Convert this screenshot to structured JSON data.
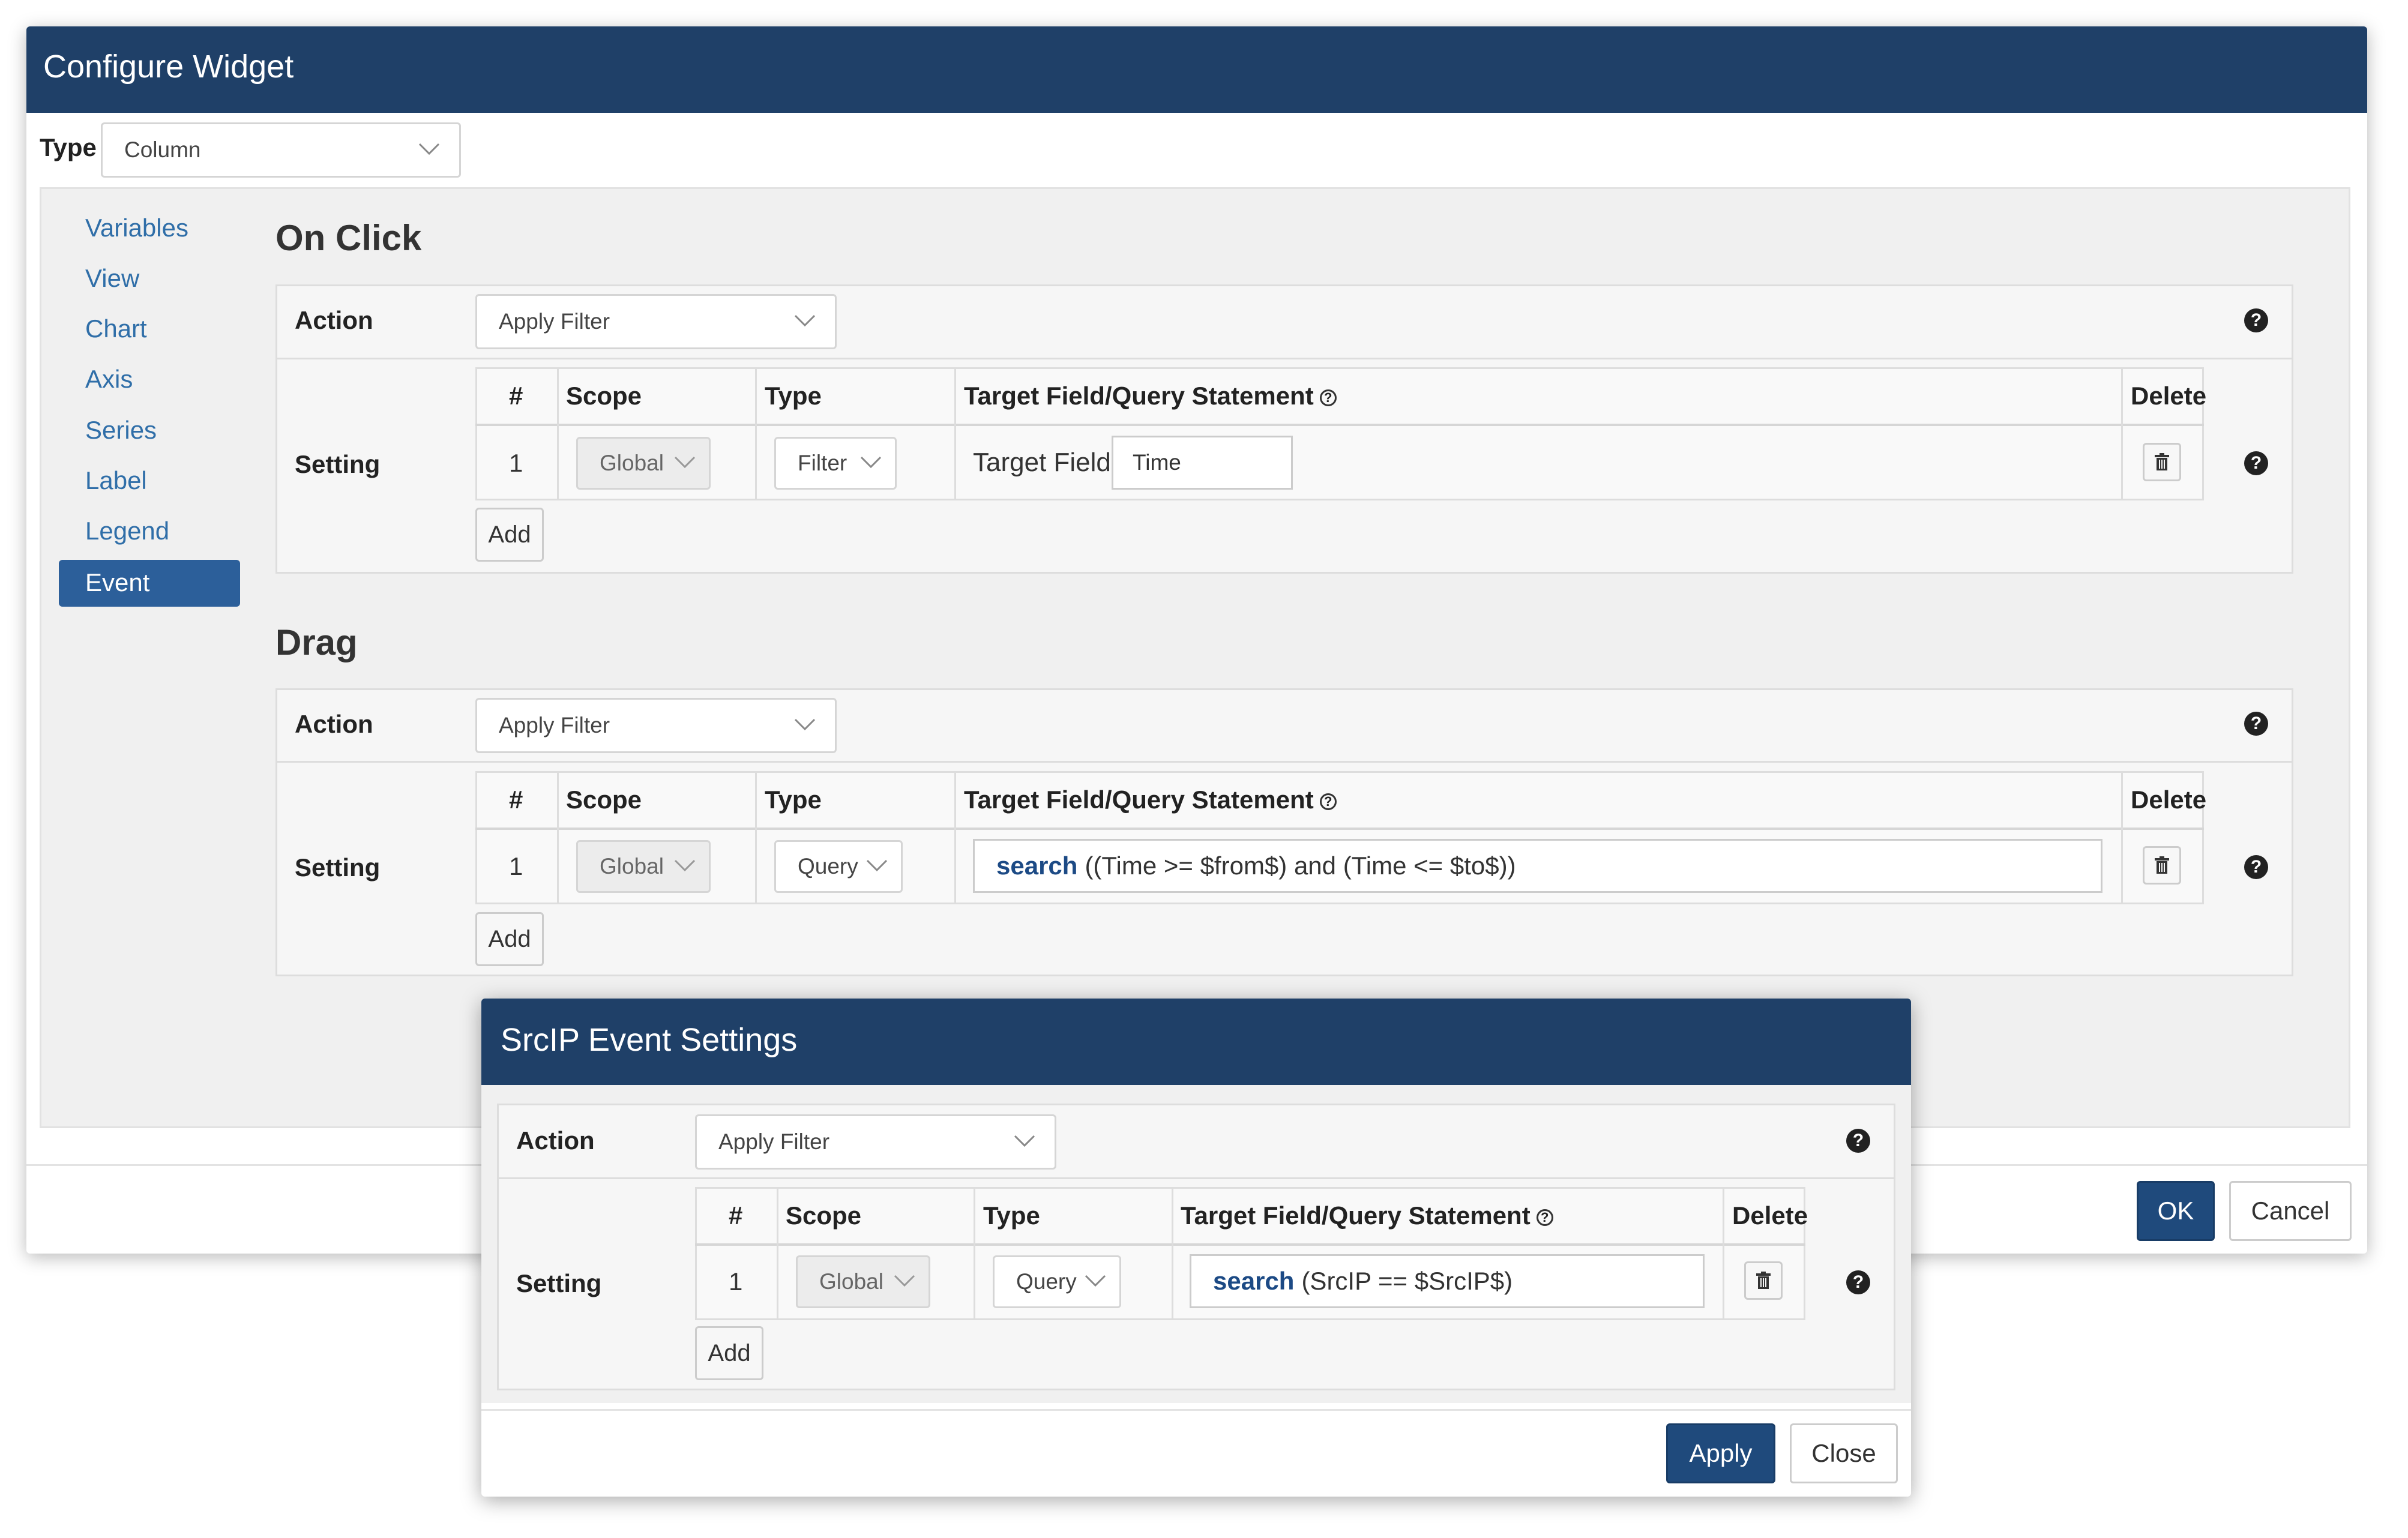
{
  "main_dialog": {
    "title": "Configure Widget",
    "type_label": "Type",
    "type_value": "Column",
    "ok_label": "OK",
    "cancel_label": "Cancel"
  },
  "nav": {
    "items": [
      {
        "label": "Variables"
      },
      {
        "label": "View"
      },
      {
        "label": "Chart"
      },
      {
        "label": "Axis"
      },
      {
        "label": "Series"
      },
      {
        "label": "Label"
      },
      {
        "label": "Legend"
      },
      {
        "label": "Event"
      }
    ],
    "active_index": 7
  },
  "table_headers": {
    "num": "#",
    "scope": "Scope",
    "type": "Type",
    "target": "Target Field/Query Statement",
    "delete": "Delete"
  },
  "labels": {
    "action": "Action",
    "setting": "Setting",
    "add": "Add"
  },
  "on_click": {
    "title": "On Click",
    "action_value": "Apply Filter",
    "row": {
      "num": "1",
      "scope": "Global",
      "type": "Filter",
      "target_field_label": "Target Field",
      "target_field_value": "Time"
    }
  },
  "drag": {
    "title": "Drag",
    "action_value": "Apply Filter",
    "row": {
      "num": "1",
      "scope": "Global",
      "type": "Query",
      "query_keyword": "search",
      "query_rest": "((Time >= $from$) and (Time <= $to$))"
    }
  },
  "srcip_dialog": {
    "title": "SrcIP Event Settings",
    "action_value": "Apply Filter",
    "row": {
      "num": "1",
      "scope": "Global",
      "type": "Query",
      "query_keyword": "search",
      "query_rest": "(SrcIP == $SrcIP$)"
    },
    "apply_label": "Apply",
    "close_label": "Close"
  },
  "colors": {
    "header_bg": "#1f4068",
    "nav_active_bg": "#2c5f9a",
    "link": "#2f6ea8",
    "primary_button": "#1f4a7c"
  }
}
